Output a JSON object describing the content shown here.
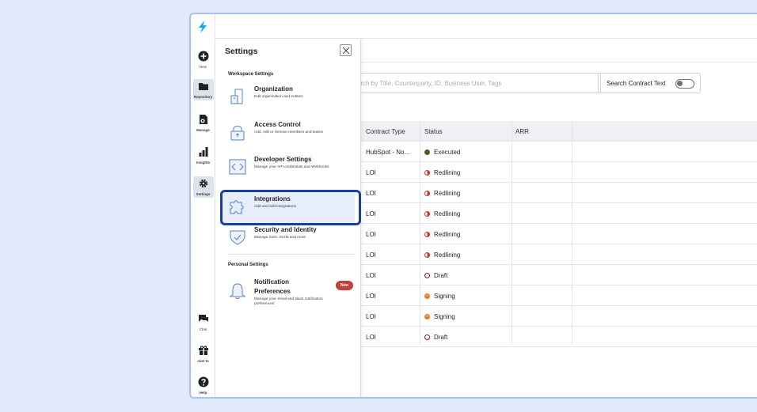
{
  "rail": {
    "items": [
      {
        "label": "New",
        "icon": "plus-circle-icon"
      },
      {
        "label": "Repository",
        "icon": "folder-icon"
      },
      {
        "label": "Manage",
        "icon": "manage-icon"
      },
      {
        "label": "Insights",
        "icon": "bar-chart-icon"
      },
      {
        "label": "Settings",
        "icon": "gear-icon"
      },
      {
        "label": "Chat",
        "icon": "chat-icon"
      },
      {
        "label": "Just In",
        "icon": "gift-icon"
      },
      {
        "label": "Help",
        "icon": "help-icon"
      }
    ]
  },
  "search": {
    "placeholder": "arch by Title, Counterparty, ID, Business User, Tags",
    "toggle_label": "Search Contract Text"
  },
  "table": {
    "columns": [
      "Contract Type",
      "Status",
      "ARR"
    ],
    "rows": [
      {
        "type": "HubSpot - No...",
        "status": "Executed",
        "status_kind": "executed"
      },
      {
        "type": "LOI",
        "status": "Redlining",
        "status_kind": "redlining"
      },
      {
        "type": "LOI",
        "status": "Redlining",
        "status_kind": "redlining"
      },
      {
        "type": "LOI",
        "status": "Redlining",
        "status_kind": "redlining"
      },
      {
        "type": "LOI",
        "status": "Redlining",
        "status_kind": "redlining"
      },
      {
        "type": "LOI",
        "status": "Redlining",
        "status_kind": "redlining"
      },
      {
        "type": "LOI",
        "status": "Draft",
        "status_kind": "draft"
      },
      {
        "type": "LOI",
        "status": "Signing",
        "status_kind": "signing"
      },
      {
        "type": "LOI",
        "status": "Signing",
        "status_kind": "signing"
      },
      {
        "type": "LOI",
        "status": "Draft",
        "status_kind": "draft"
      }
    ]
  },
  "settings": {
    "title": "Settings",
    "workspace_label": "Workspace Settings",
    "personal_label": "Personal Settings",
    "items": [
      {
        "title": "Organization",
        "desc": "Edit organization and entities",
        "icon": "building-icon"
      },
      {
        "title": "Access Control",
        "desc": "Add, edit or remove members and teams",
        "icon": "lock-icon"
      },
      {
        "title": "Developer Settings",
        "desc": "Manage your API credentials and Webhooks",
        "icon": "code-icon"
      },
      {
        "title": "Integrations",
        "desc": "Add and edit integrations",
        "icon": "puzzle-icon"
      },
      {
        "title": "Security and Identity",
        "desc": "Manage SSO, SCIM and more",
        "icon": "shield-icon"
      }
    ],
    "notification": {
      "title": "Notification Preferences",
      "desc": "Manage your email and slack notification preferences",
      "badge": "New",
      "icon": "bell-icon"
    }
  },
  "colors": {
    "accent": "#1d3f99",
    "background": "#e2eafb",
    "logo": "#1aa3e8",
    "badge": "#c2413b"
  }
}
